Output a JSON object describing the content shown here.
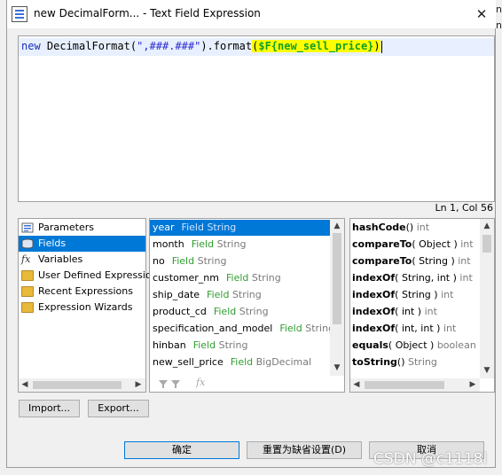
{
  "window": {
    "title": "new DecimalForm... - Text Field Expression",
    "close_glyph": "✕"
  },
  "editor": {
    "code_kw": "new",
    "code_class": " DecimalFormat(",
    "code_string": "\",###.###\"",
    "code_mid": ").format",
    "code_paren_open": "(",
    "code_field": "$F{new_sell_price}",
    "code_paren_close": ")"
  },
  "status": {
    "position": "Ln 1, Col 56"
  },
  "categories": [
    {
      "label": "Parameters",
      "icon": "parameters-icon"
    },
    {
      "label": "Fields",
      "icon": "fields-icon",
      "selected": true
    },
    {
      "label": "Variables",
      "icon": "fx-icon"
    },
    {
      "label": "User Defined Expressio",
      "icon": "folder-icon"
    },
    {
      "label": "Recent Expressions",
      "icon": "folder-icon"
    },
    {
      "label": "Expression Wizards",
      "icon": "folder-icon"
    }
  ],
  "fields": [
    {
      "name": "year",
      "kind": "Field",
      "type": "String",
      "selected": true
    },
    {
      "name": "month",
      "kind": "Field",
      "type": "String"
    },
    {
      "name": "no",
      "kind": "Field",
      "type": "String"
    },
    {
      "name": "customer_nm",
      "kind": "Field",
      "type": "String"
    },
    {
      "name": "ship_date",
      "kind": "Field",
      "type": "String"
    },
    {
      "name": "product_cd",
      "kind": "Field",
      "type": "String"
    },
    {
      "name": "specification_and_model",
      "kind": "Field",
      "type": "String"
    },
    {
      "name": "hinban",
      "kind": "Field",
      "type": "String"
    },
    {
      "name": "new_sell_price",
      "kind": "Field",
      "type": "BigDecimal"
    }
  ],
  "methods": [
    {
      "name": "hashCode",
      "args": "()",
      "ret": "int"
    },
    {
      "name": "compareTo",
      "args": "( Object )",
      "ret": "int"
    },
    {
      "name": "compareTo",
      "args": "( String )",
      "ret": "int"
    },
    {
      "name": "indexOf",
      "args": "( String, int )",
      "ret": "int"
    },
    {
      "name": "indexOf",
      "args": "( String )",
      "ret": "int"
    },
    {
      "name": "indexOf",
      "args": "( int )",
      "ret": "int"
    },
    {
      "name": "indexOf",
      "args": "( int, int )",
      "ret": "int"
    },
    {
      "name": "equals",
      "args": "( Object )",
      "ret": "boolean"
    },
    {
      "name": "toString",
      "args": "()",
      "ret": "String"
    }
  ],
  "buttons": {
    "import": "Import...",
    "export": "Export...",
    "ok": "确定",
    "reset": "重置为缺省设置(D)",
    "cancel": "取消"
  },
  "watermark": "CSDN @c1118l",
  "colors": {
    "selection": "#0078d7",
    "field_type": "#2f9c2f",
    "keyword": "#1a2db5",
    "highlight": "#ffff00"
  }
}
